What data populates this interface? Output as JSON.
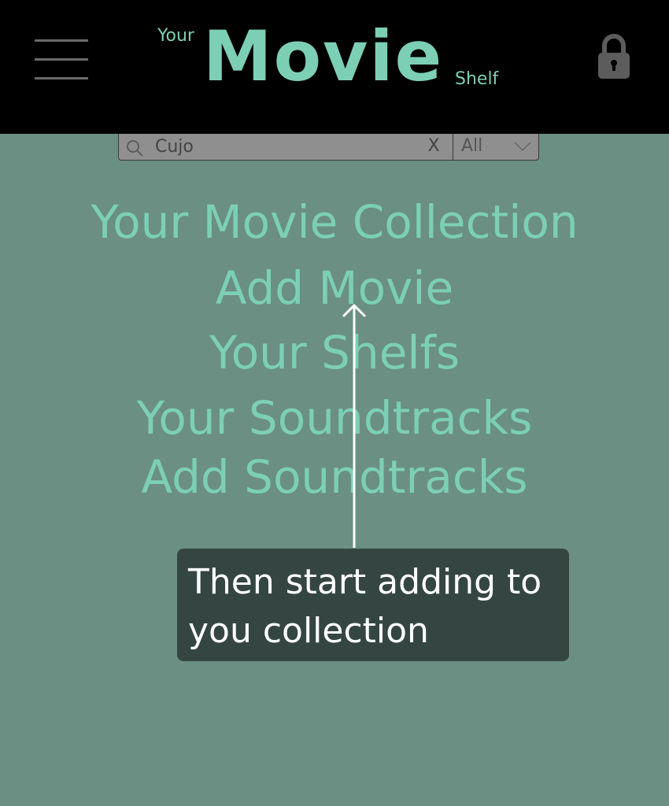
{
  "header": {
    "logo_your": "Your",
    "logo_movie": "Movie",
    "logo_shelf": "Shelf",
    "menu_icon": "hamburger-menu-icon",
    "lock_icon": "lock-icon"
  },
  "search": {
    "value": "Cujo",
    "clear_label": "X",
    "filter_selected": "All",
    "search_icon": "search-icon",
    "chevron_icon": "chevron-down-icon"
  },
  "nav": {
    "items": [
      {
        "label": "Your Movie Collection"
      },
      {
        "label": "Add Movie"
      },
      {
        "label": "Your Shelfs"
      },
      {
        "label": "Your Soundtracks"
      },
      {
        "label": "Add Soundtracks"
      }
    ]
  },
  "tooltip": {
    "text": "Then start adding to you collection"
  },
  "colors": {
    "accent": "#7ccfb5",
    "background": "#6b8f83",
    "header_bg": "#000000",
    "tooltip_bg": "#354642"
  }
}
